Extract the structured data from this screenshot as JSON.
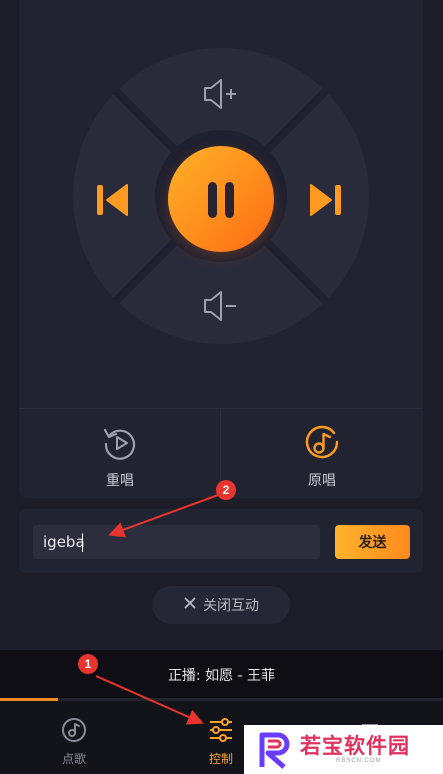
{
  "colors": {
    "accent": "#ff9a22",
    "background": "#1c1d29",
    "panel": "#222331",
    "annotation": "#e8352e"
  },
  "remote": {
    "icons": {
      "volume_up": "volume-up-icon",
      "volume_down": "volume-down-icon",
      "prev": "skip-previous-icon",
      "next": "skip-next-icon",
      "pause": "pause-icon"
    }
  },
  "actions": [
    {
      "label": "重唱",
      "icon": "replay-icon"
    },
    {
      "label": "原唱",
      "icon": "music-note-disc-icon"
    }
  ],
  "message": {
    "value": "igeba",
    "send_label": "发送"
  },
  "close_interaction": {
    "icon": "close-icon",
    "label": "关闭互动"
  },
  "now_playing": {
    "text": "正播: 如愿 - 王菲",
    "progress": 0.13
  },
  "tabs": [
    {
      "label": "点歌",
      "icon": "music-note-icon",
      "active": false
    },
    {
      "label": "控制",
      "icon": "sliders-icon",
      "active": true
    }
  ],
  "annotations": [
    {
      "number": "1"
    },
    {
      "number": "2"
    }
  ],
  "watermark": {
    "text": "若宝软件园",
    "sub": "RBSCN.COM"
  }
}
